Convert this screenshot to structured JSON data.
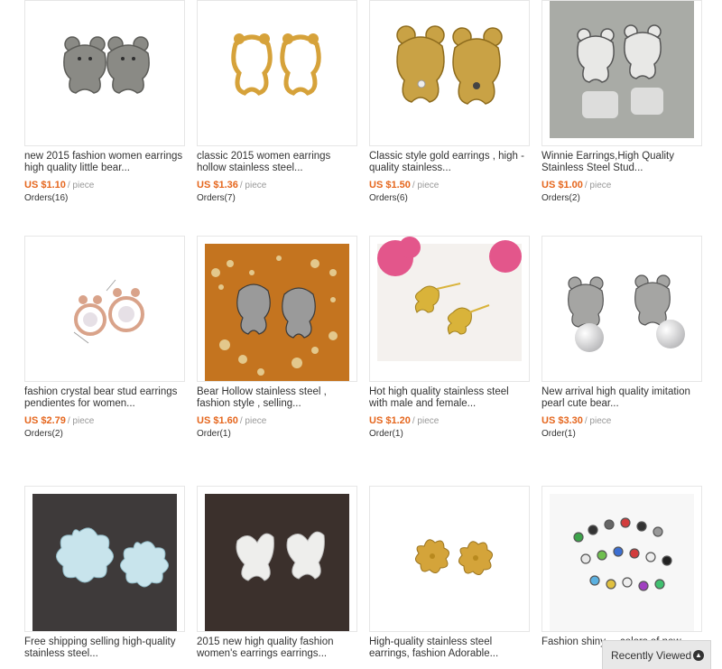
{
  "products": [
    {
      "title": "new 2015 fashion women earrings high quality little bear...",
      "price": "US $1.10",
      "unit": "/ piece",
      "orders": "Orders(16)",
      "image_icon": "silver-bear-earrings"
    },
    {
      "title": "classic 2015 women earrings hollow stainless steel...",
      "price": "US $1.36",
      "unit": "/ piece",
      "orders": "Orders(7)",
      "image_icon": "gold-hollow-bear-earrings"
    },
    {
      "title": "Classic style gold earrings , high - quality stainless...",
      "price": "US $1.50",
      "unit": "/ piece",
      "orders": "Orders(6)",
      "image_icon": "gold-bear-earrings"
    },
    {
      "title": "Winnie Earrings,High Quality Stainless Steel Stud...",
      "price": "US $1.00",
      "unit": "/ piece",
      "orders": "Orders(2)",
      "image_icon": "silver-bear-earrings-grey"
    },
    {
      "title": "fashion crystal bear stud earrings pendientes for women...",
      "price": "US $2.79",
      "unit": "/ piece",
      "orders": "Orders(2)",
      "image_icon": "rose-gold-crystal-earrings"
    },
    {
      "title": "Bear Hollow stainless steel , fashion style , selling...",
      "price": "US $1.60",
      "unit": "/ piece",
      "orders": "Order(1)",
      "image_icon": "bear-earrings-orange-bg"
    },
    {
      "title": "Hot high quality stainless steel with male and female...",
      "price": "US $1.20",
      "unit": "/ piece",
      "orders": "Order(1)",
      "image_icon": "gold-stud-earrings-flowers"
    },
    {
      "title": "New arrival high quality imitation pearl cute bear...",
      "price": "US $3.30",
      "unit": "/ piece",
      "orders": "Order(1)",
      "image_icon": "bear-pearl-earrings"
    },
    {
      "title": "Free shipping selling high-quality stainless steel...",
      "price": "",
      "unit": "",
      "orders": "",
      "image_icon": "silver-flower-earrings"
    },
    {
      "title": "2015 new high quality fashion women's earrings earrings...",
      "price": "",
      "unit": "",
      "orders": "",
      "image_icon": "silver-butterfly-earrings"
    },
    {
      "title": "High-quality stainless steel earrings, fashion Adorable...",
      "price": "",
      "unit": "",
      "orders": "",
      "image_icon": "gold-flower-earrings"
    },
    {
      "title": "Fashion shiny ... colors of new...",
      "price": "",
      "unit": "",
      "orders": "",
      "image_icon": "crystal-stud-earrings-set"
    }
  ],
  "recently_viewed": {
    "label": "Recently Viewed",
    "icon": "chevron-up-icon"
  },
  "colors": {
    "price": "#e5661d",
    "border": "#e6e6e6"
  }
}
